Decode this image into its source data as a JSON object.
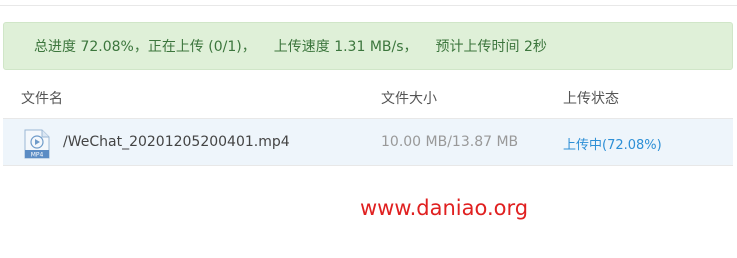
{
  "progress_banner": {
    "overall_progress": "总进度 72.08%，正在上传 (0/1)，",
    "upload_speed": "上传速度 1.31 MB/s，",
    "estimated_time": "预计上传时间 2秒"
  },
  "table": {
    "headers": {
      "name": "文件名",
      "size": "文件大小",
      "status": "上传状态"
    },
    "rows": [
      {
        "icon": "mp4-file-icon",
        "icon_label": "MP4",
        "name": "/WeChat_20201205200401.mp4",
        "size": "10.00 MB/13.87 MB",
        "status": "上传中(72.08%)"
      }
    ]
  },
  "watermark": "www.daniao.org",
  "colors": {
    "banner_bg": "#dff0d8",
    "banner_text": "#3c763d",
    "row_highlight": "#eef5fb",
    "status_text": "#2d8fd6",
    "watermark": "#e02020"
  }
}
